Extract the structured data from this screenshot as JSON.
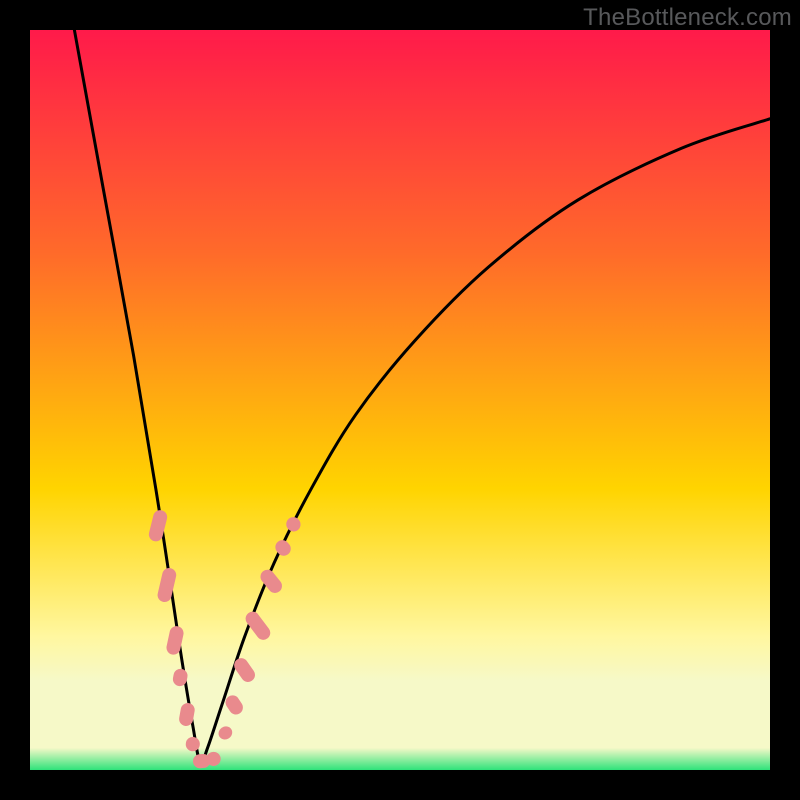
{
  "watermark": "TheBottleneck.com",
  "colors": {
    "background_black": "#000000",
    "gradient_top": "#ff1a4a",
    "gradient_mid1": "#ff6a2a",
    "gradient_mid2": "#ffd400",
    "gradient_low": "#fff7a0",
    "gradient_band_pale": "#f6f9c8",
    "gradient_bottom": "#2fe37a",
    "curve_stroke": "#000000",
    "marker_fill": "#e98a8d"
  },
  "chart_data": {
    "type": "line",
    "title": "",
    "xlabel": "",
    "ylabel": "",
    "xlim": [
      0,
      100
    ],
    "ylim": [
      0,
      100
    ],
    "note": "Axes are unlabeled in the source image; x/y are normalized 0–100 read from geometry. The curve is a V-shaped bottleneck curve with minimum near x≈23. Markers are short pill-shaped segments along the curve near the trough.",
    "series": [
      {
        "name": "bottleneck-curve",
        "x": [
          6,
          10,
          14,
          17,
          19,
          20.5,
          22,
          23,
          24,
          26,
          29,
          33,
          38,
          44,
          52,
          62,
          74,
          88,
          100
        ],
        "y": [
          100,
          78,
          56,
          38,
          25,
          15,
          6,
          1,
          3,
          9,
          18,
          28,
          38,
          48,
          58,
          68,
          77,
          84,
          88
        ]
      }
    ],
    "markers": [
      {
        "x": 17.3,
        "y": 33.0,
        "len": 5.5,
        "angle_deg": 76
      },
      {
        "x": 18.5,
        "y": 25.0,
        "len": 6.0,
        "angle_deg": 77
      },
      {
        "x": 19.6,
        "y": 17.5,
        "len": 5.0,
        "angle_deg": 78
      },
      {
        "x": 20.3,
        "y": 12.5,
        "len": 3.0,
        "angle_deg": 79
      },
      {
        "x": 21.2,
        "y": 7.5,
        "len": 4.0,
        "angle_deg": 80
      },
      {
        "x": 22.0,
        "y": 3.5,
        "len": 2.5,
        "angle_deg": 82
      },
      {
        "x": 23.2,
        "y": 1.2,
        "len": 3.0,
        "angle_deg": 5
      },
      {
        "x": 24.8,
        "y": 1.5,
        "len": 2.5,
        "angle_deg": -10
      },
      {
        "x": 26.4,
        "y": 5.0,
        "len": 2.2,
        "angle_deg": -58
      },
      {
        "x": 27.6,
        "y": 8.8,
        "len": 3.5,
        "angle_deg": -57
      },
      {
        "x": 29.0,
        "y": 13.5,
        "len": 4.5,
        "angle_deg": -55
      },
      {
        "x": 30.8,
        "y": 19.5,
        "len": 5.5,
        "angle_deg": -53
      },
      {
        "x": 32.6,
        "y": 25.5,
        "len": 4.5,
        "angle_deg": -51
      },
      {
        "x": 34.2,
        "y": 30.0,
        "len": 2.8,
        "angle_deg": -49
      },
      {
        "x": 35.6,
        "y": 33.2,
        "len": 2.5,
        "angle_deg": -47
      }
    ],
    "gradient_stops_pct": [
      {
        "offset": 0,
        "color_key": "gradient_top"
      },
      {
        "offset": 30,
        "color_key": "gradient_mid1"
      },
      {
        "offset": 62,
        "color_key": "gradient_mid2"
      },
      {
        "offset": 82,
        "color_key": "gradient_low"
      },
      {
        "offset": 88,
        "color_key": "gradient_band_pale"
      },
      {
        "offset": 97,
        "color_key": "gradient_band_pale"
      },
      {
        "offset": 100,
        "color_key": "gradient_bottom"
      }
    ]
  }
}
